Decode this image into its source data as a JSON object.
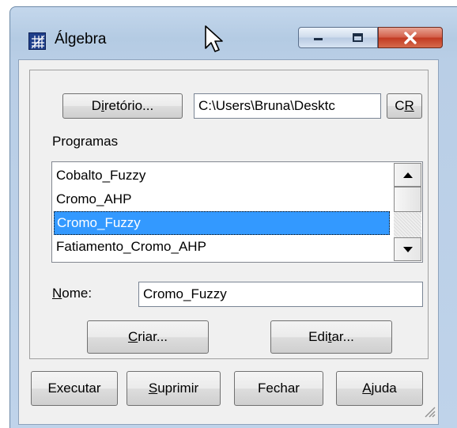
{
  "window": {
    "title": "Álgebra",
    "app_icon": "grid-icon",
    "controls": {
      "minimize": "minimize-icon",
      "maximize": "maximize-icon",
      "close": "close-icon"
    }
  },
  "directory": {
    "button_pre": "D",
    "button_under": "i",
    "button_post": "retório...",
    "path_value": "C:\\Users\\Bruna\\Desktc",
    "cr_pre": "C",
    "cr_under": "R"
  },
  "programs": {
    "label": "Programas",
    "items": [
      "Cobalto_Fuzzy",
      "Cromo_AHP",
      "Cromo_Fuzzy",
      "Fatiamento_Cromo_AHP"
    ],
    "selected_index": 2
  },
  "name_field": {
    "label_under": "N",
    "label_post": "ome:",
    "value": "Cromo_Fuzzy"
  },
  "actions": {
    "create_under": "C",
    "create_post": "riar...",
    "edit_pre": "Edi",
    "edit_under": "t",
    "edit_post": "ar..."
  },
  "footer": {
    "execute": "Executar",
    "delete_under": "S",
    "delete_post": "uprimir",
    "close": "Fechar",
    "help_under": "A",
    "help_post": "juda"
  },
  "colors": {
    "selection": "#3399ff",
    "close_button": "#c23a22",
    "window_frame": "#b9cee6"
  }
}
